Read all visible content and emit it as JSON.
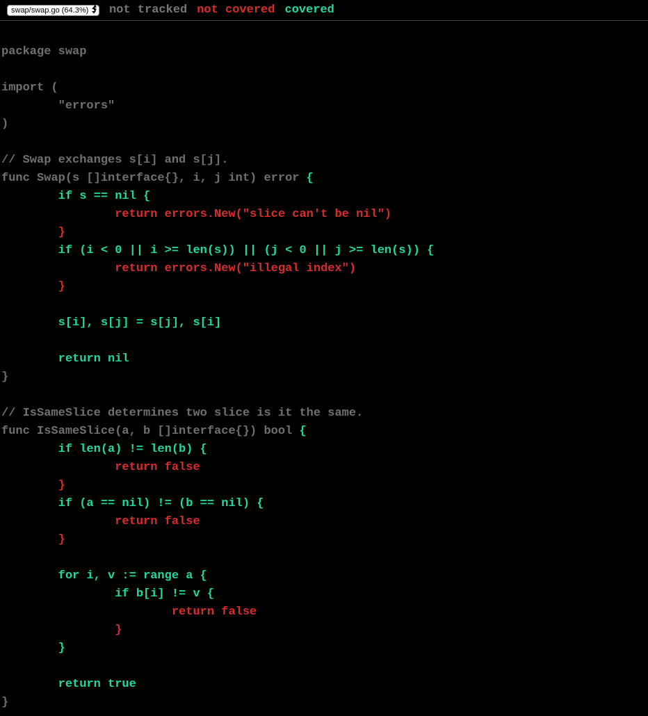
{
  "header": {
    "file_selector": "swap/swap.go (64.3%)",
    "legend": {
      "not_tracked": "not tracked",
      "not_covered": "not covered",
      "covered": "covered"
    }
  },
  "code": {
    "l1": "package swap",
    "l2": "",
    "l3": "import (",
    "l4": "        \"errors\"",
    "l5": ")",
    "l6": "",
    "l7": "// Swap exchanges s[i] and s[j].",
    "l8a": "func Swap(s []interface{}, i, j int) error ",
    "l8b": "{",
    "l9": "        if s == nil {",
    "l10": "                return errors.New(\"slice can't be nil\")",
    "l11": "        }",
    "l12": "        if (i < 0 || i >= len(s)) || (j < 0 || j >= len(s)) {",
    "l13": "                return errors.New(\"illegal index\")",
    "l14": "        }",
    "l15": "",
    "l16": "        s[i], s[j] = s[j], s[i]",
    "l17": "",
    "l18": "        return nil",
    "l19": "}",
    "l20": "",
    "l21": "// IsSameSlice determines two slice is it the same.",
    "l22a": "func IsSameSlice(a, b []interface{}) bool ",
    "l22b": "{",
    "l23": "        if len(a) != len(b) {",
    "l24": "                return false",
    "l25": "        }",
    "l26": "        if (a == nil) != (b == nil) {",
    "l27": "                return false",
    "l28": "        }",
    "l29": "",
    "l30": "        for i, v := range a {",
    "l31": "                if b[i] != v {",
    "l32": "                        return false",
    "l33": "                }",
    "l34": "        }",
    "l35": "",
    "l36": "        return true",
    "l37": "}"
  }
}
